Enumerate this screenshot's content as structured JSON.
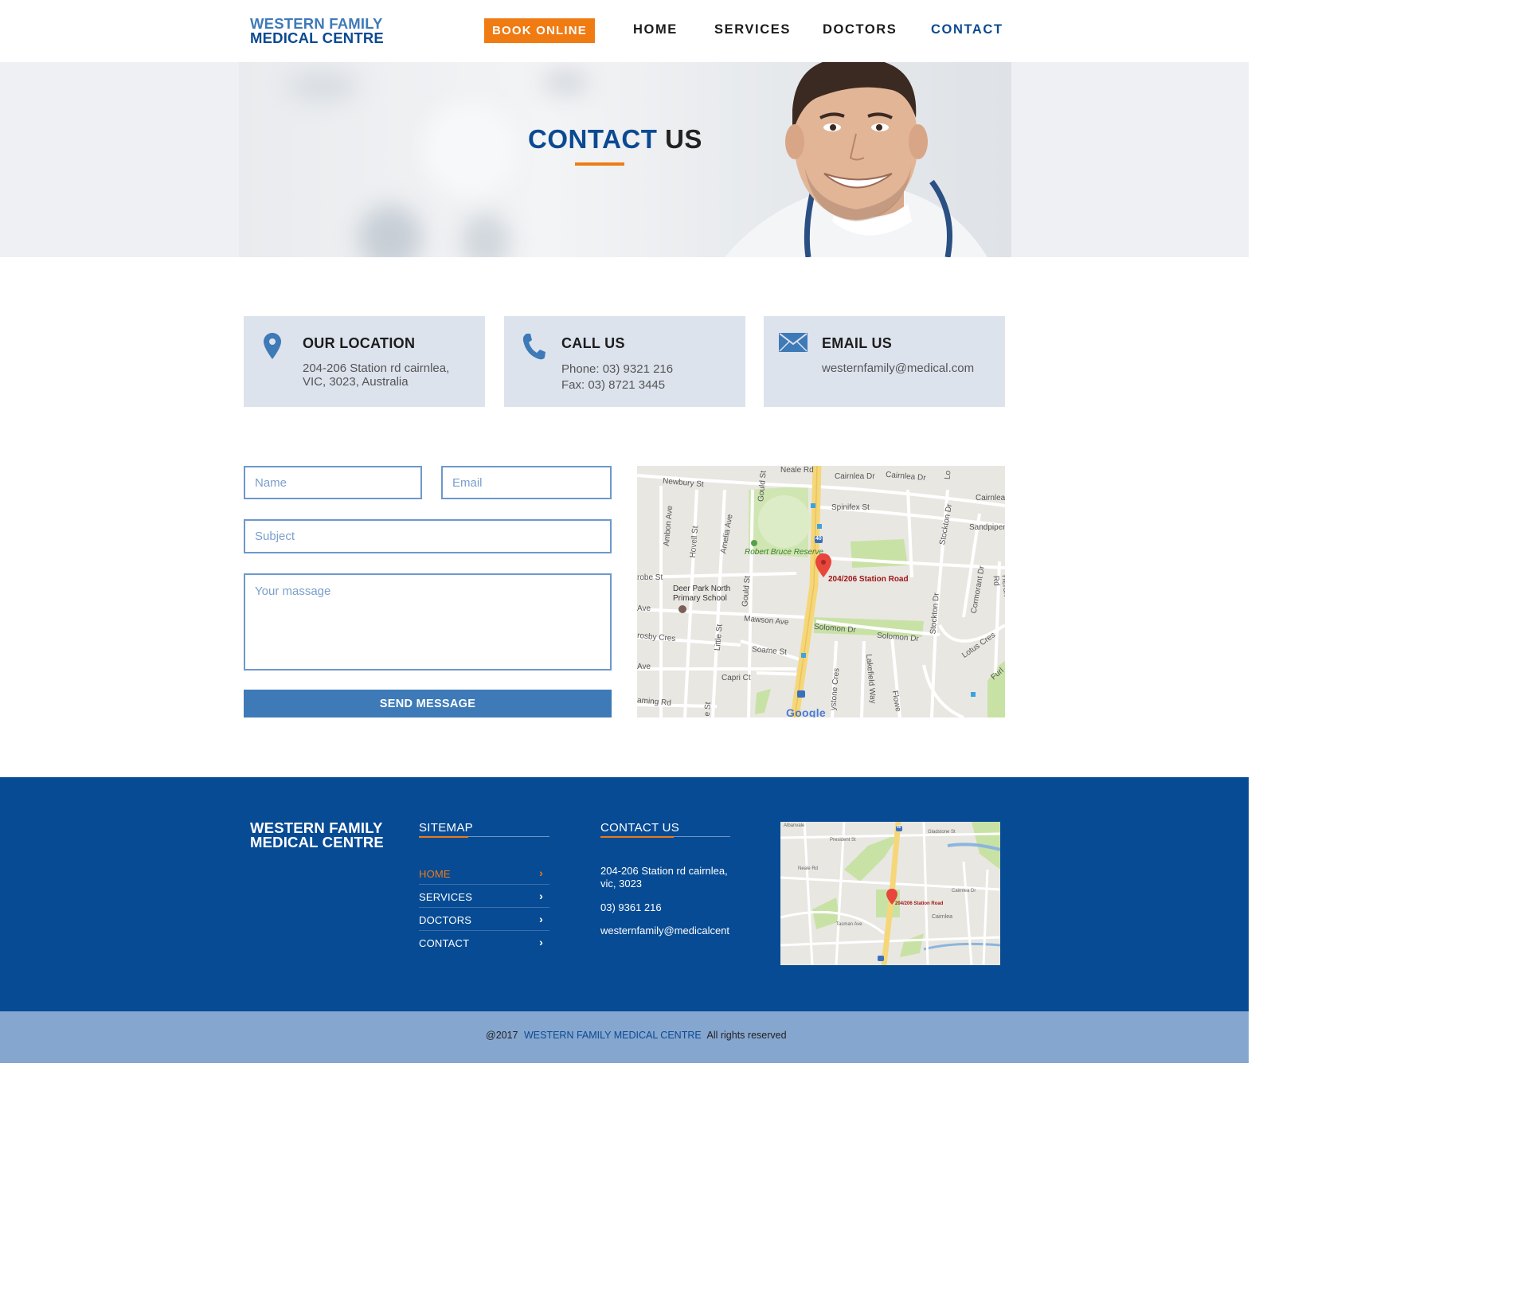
{
  "header": {
    "logo_line1": "WESTERN FAMILY",
    "logo_line2": "MEDICAL CENTRE",
    "book_label": "BOOK ONLINE",
    "nav": [
      "HOME",
      "SERVICES",
      "DOCTORS",
      "CONTACT"
    ],
    "active_nav": "CONTACT"
  },
  "hero": {
    "title_part1": "CONTACT",
    "title_part2": "US"
  },
  "info": {
    "location": {
      "title": "OUR LOCATION",
      "line1": "204-206 Station rd cairnlea,",
      "line2": "VIC, 3023, Australia"
    },
    "call": {
      "title": "CALL US",
      "line1": "Phone: 03) 9321 216",
      "line2": "Fax: 03) 8721 3445"
    },
    "email": {
      "title": "EMAIL US",
      "line1": "westernfamily@medical.com"
    }
  },
  "form": {
    "name_placeholder": "Name",
    "email_placeholder": "Email",
    "subject_placeholder": "Subject",
    "message_placeholder": "Your massage",
    "send_label": "SEND MESSAGE"
  },
  "map": {
    "marker_label": "204/206 Station Road",
    "streets": [
      "Neale Rd",
      "Newbury St",
      "Cairnlea Dr",
      "Cairnlea Dr",
      "Cairnlea",
      "Gould St",
      "Spinifex St",
      "Sandpiper",
      "Lo",
      "Ambon Ave",
      "Hovell St",
      "Amelia Ave",
      "Robert Bruce Reserve",
      "Stockton Dr",
      "robe St",
      "Deer Park North",
      "Primary School",
      "Gould St",
      "Cormorant Dr",
      "Heron Rd",
      "Ave",
      "Mawson Ave",
      "Solomon Dr",
      "Solomon Dr",
      "Stockton Dr",
      "rosby Cres",
      "Little St",
      "Soame St",
      "Lotus Cres",
      "Ave",
      "Capri Ct",
      "Lakefield Way",
      "ystone Cres",
      "Flowe",
      "Furl",
      "aming Rd",
      "e St"
    ],
    "google_label": "Google",
    "route_badge": "40"
  },
  "footer": {
    "logo_line1": "WESTERN FAMILY",
    "logo_line2": "MEDICAL CENTRE",
    "sitemap_title": "SITEMAP",
    "sitemap": [
      "HOME",
      "SERVICES",
      "DOCTORS",
      "CONTACT"
    ],
    "active_sitemap": "HOME",
    "contact_title": "CONTACT US",
    "address_line1": "204-206 Station rd cairnlea,",
    "address_line2": "vic, 3023",
    "phone": "03) 9361 216",
    "email": "westernfamily@medicalcent",
    "map_marker_label": "204/206 Station Road",
    "map_streets": [
      "Albanvale",
      "President St",
      "Gladstone St",
      "Neale Rd",
      "Cairnlea Dr",
      "Cairnlea",
      "Tasman Ave"
    ],
    "map_route_badge": "40"
  },
  "bottom": {
    "copyright_prefix": "@2017",
    "brand": "WESTERN FAMILY MEDICAL CENTRE",
    "rights": "All rights reserved"
  },
  "colors": {
    "brand_blue": "#0b4a92",
    "accent_orange": "#f07b12",
    "light_blue": "#3e7ab7",
    "info_box_bg": "#dde3ed",
    "footer_bg": "#074b94",
    "bottom_bar_bg": "#85a6cf"
  }
}
